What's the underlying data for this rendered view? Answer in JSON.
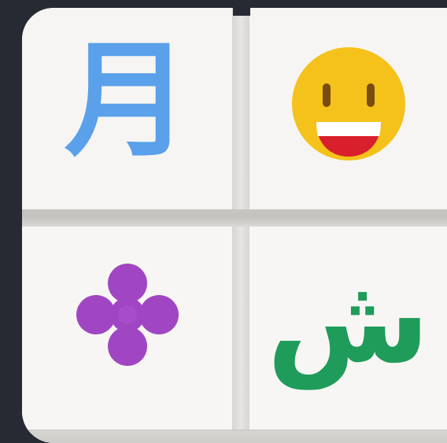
{
  "icon_tiles": {
    "top_left": {
      "glyph": "月",
      "color": "#5aa0ea"
    },
    "top_right": {
      "icon": "grinning-face-emoji-icon",
      "face_color": "#f4c21a",
      "eye_color": "#7a4b12",
      "mouth_color": "#d91f2b",
      "teeth_color": "#ffffff"
    },
    "bottom_left": {
      "icon": "four-petal-flower-icon",
      "color": "#a046c3"
    },
    "bottom_right": {
      "glyph": "ش",
      "color": "#1f9b5a"
    }
  },
  "background_color": "#262a33"
}
